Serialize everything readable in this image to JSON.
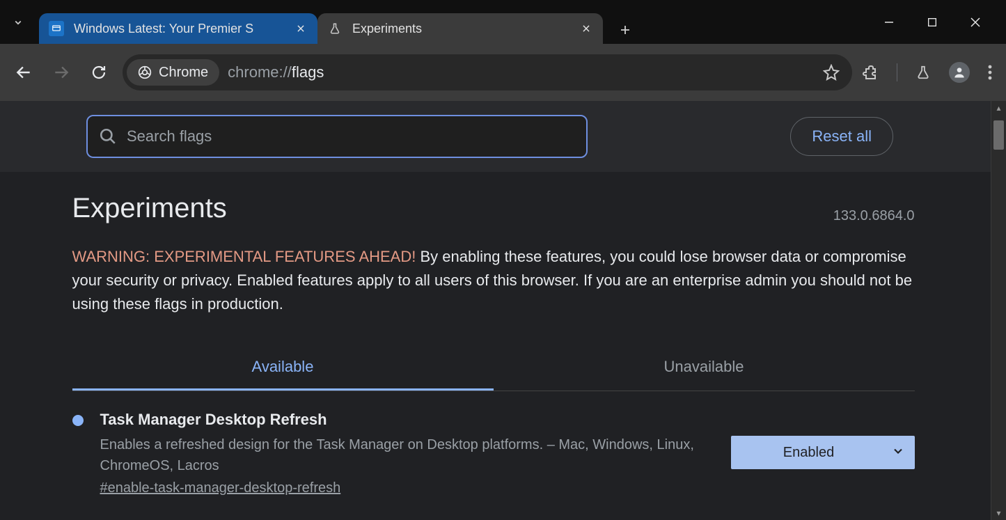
{
  "tabs": [
    {
      "title": "Windows Latest: Your Premier S",
      "active": false
    },
    {
      "title": "Experiments",
      "active": true
    }
  ],
  "omnibox": {
    "chip_label": "Chrome",
    "url_prefix": "chrome://",
    "url_path": "flags"
  },
  "page": {
    "search_placeholder": "Search flags",
    "reset_label": "Reset all",
    "heading": "Experiments",
    "version": "133.0.6864.0",
    "warning_label": "WARNING: EXPERIMENTAL FEATURES AHEAD!",
    "warning_body": "By enabling these features, you could lose browser data or compromise your security or privacy. Enabled features apply to all users of this browser. If you are an enterprise admin you should not be using these flags in production.",
    "tab_available": "Available",
    "tab_unavailable": "Unavailable",
    "flags": [
      {
        "title": "Task Manager Desktop Refresh",
        "description": "Enables a refreshed design for the Task Manager on Desktop platforms. – Mac, Windows, Linux, ChromeOS, Lacros",
        "hash": "#enable-task-manager-desktop-refresh",
        "value": "Enabled"
      }
    ]
  }
}
